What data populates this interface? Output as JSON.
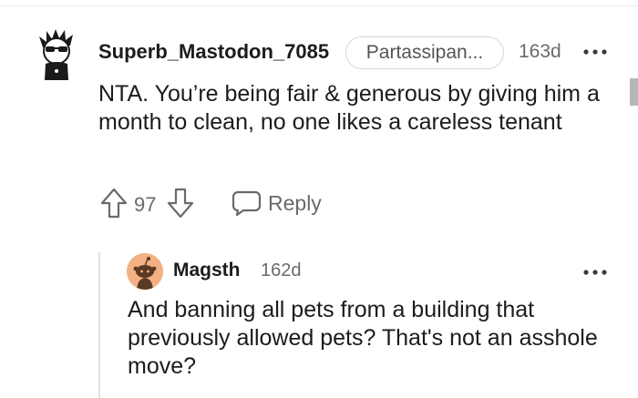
{
  "comment": {
    "username": "Superb_Mastodon_7085",
    "flair": "Partassipan...",
    "age": "163d",
    "more_icon": "more-horizontal-icon",
    "body": "NTA. You’re being fair & generous by giving him a month to clean, no one likes a careless tenant",
    "vote_count": "97",
    "reply_label": "Reply",
    "upvote_icon": "upvote-arrow-icon",
    "downvote_icon": "downvote-arrow-icon",
    "reply_icon": "speech-bubble-icon"
  },
  "reply": {
    "username": "Magsth",
    "age": "162d",
    "avatar_color": "#f4b183",
    "more_icon": "more-horizontal-icon",
    "body": "And banning all pets from a building that previously allowed pets? That's not an asshole move?"
  }
}
